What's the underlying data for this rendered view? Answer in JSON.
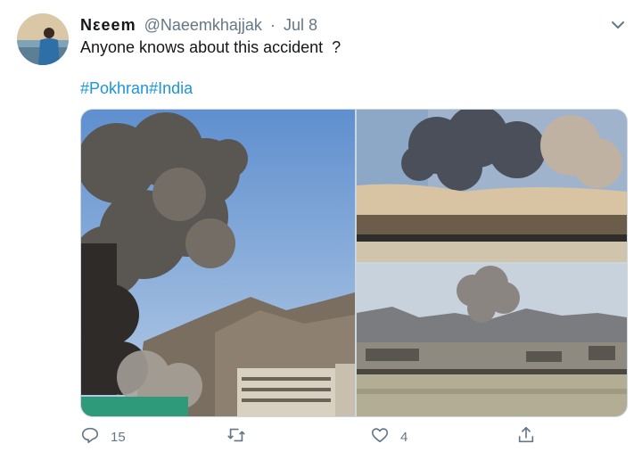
{
  "tweet": {
    "author_name": "Nεeem",
    "handle": "@Naeemkhajjak",
    "separator": "·",
    "date": "Jul 8",
    "text": "Anyone knows about this accident  ?",
    "hashtags": [
      "#Pokhran",
      "#India"
    ]
  },
  "actions": {
    "reply_count": "15",
    "like_count": "4"
  },
  "icons": {
    "reply": "reply-icon",
    "retweet": "retweet-icon",
    "like": "heart-icon",
    "share": "share-icon",
    "menu": "chevron-down-icon"
  },
  "colors": {
    "link": "#1b95e0",
    "secondary_text": "#657786",
    "primary_text": "#14171a"
  }
}
